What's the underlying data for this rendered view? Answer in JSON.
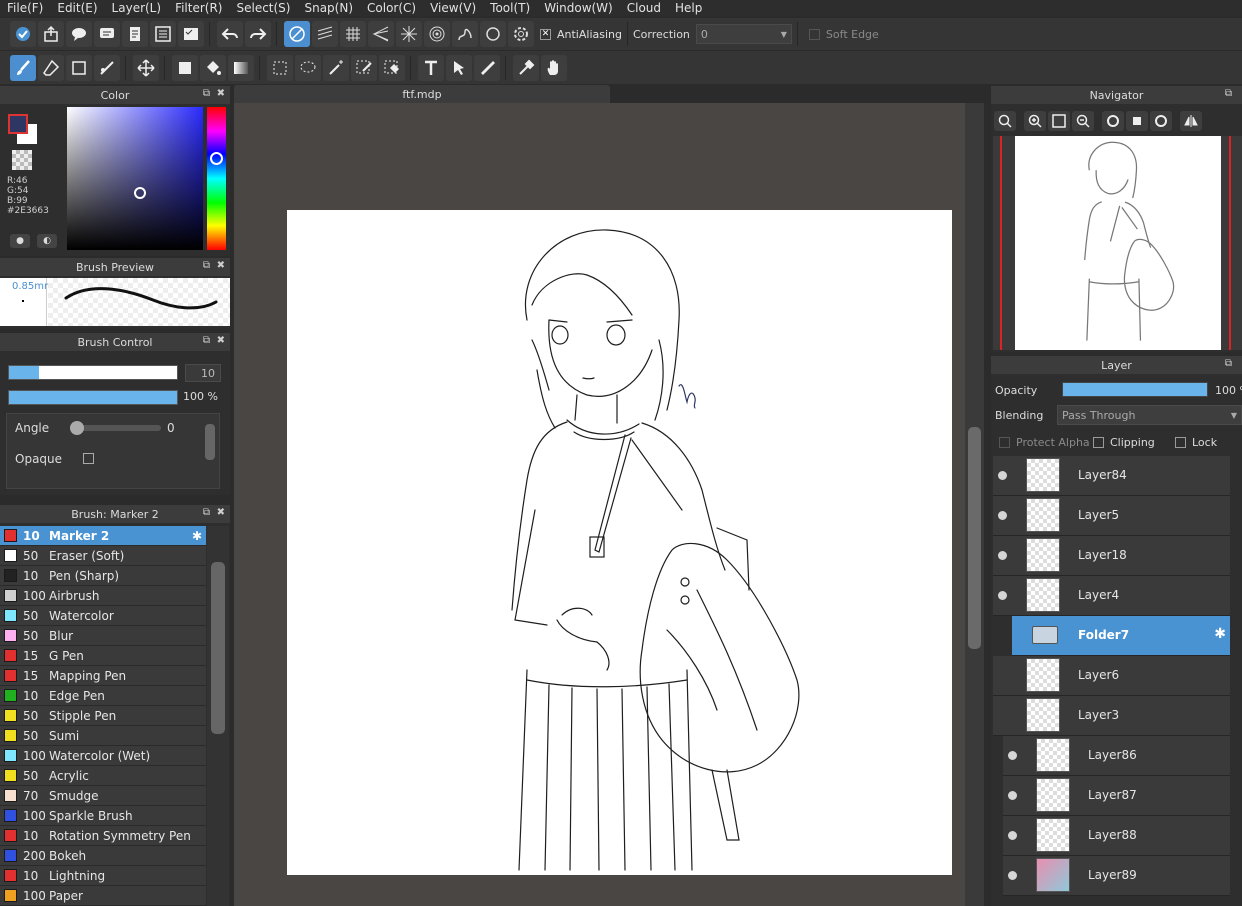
{
  "menu": [
    "File(F)",
    "Edit(E)",
    "Layer(L)",
    "Filter(R)",
    "Select(S)",
    "Snap(N)",
    "Color(C)",
    "View(V)",
    "Tool(T)",
    "Window(W)",
    "Cloud",
    "Help"
  ],
  "toolbar": {
    "antialiasing_label": "AntiAliasing",
    "correction_label": "Correction",
    "correction_value": "0",
    "soft_edge_label": "Soft Edge"
  },
  "color_panel": {
    "title": "Color",
    "r": "R:46",
    "g": "G:54",
    "b": "B:99",
    "hex": "#2E3663"
  },
  "brush_preview": {
    "title": "Brush Preview",
    "size": "0.85mm"
  },
  "brush_control": {
    "title": "Brush Control",
    "size_value": "10",
    "opacity_value": "100 %",
    "opacity_level": 1.0,
    "size_level": 0.18,
    "angle_label": "Angle",
    "angle_value": "0",
    "opaque_label": "Opaque"
  },
  "brush_list": {
    "title": "Brush: Marker 2",
    "items": [
      {
        "size": "10",
        "name": "Marker 2",
        "color": "#e03030",
        "selected": true
      },
      {
        "size": "50",
        "name": "Eraser (Soft)",
        "color": "#ffffff"
      },
      {
        "size": "10",
        "name": "Pen (Sharp)",
        "color": "#222222"
      },
      {
        "size": "100",
        "name": "Airbrush",
        "color": "#d0d0d0"
      },
      {
        "size": "50",
        "name": "Watercolor",
        "color": "#7fe6ff"
      },
      {
        "size": "50",
        "name": "Blur",
        "color": "#ffb0f0"
      },
      {
        "size": "15",
        "name": "G Pen",
        "color": "#e03030"
      },
      {
        "size": "15",
        "name": "Mapping Pen",
        "color": "#e03030"
      },
      {
        "size": "10",
        "name": "Edge Pen",
        "color": "#20b020"
      },
      {
        "size": "50",
        "name": "Stipple Pen",
        "color": "#f0e020"
      },
      {
        "size": "50",
        "name": "Sumi",
        "color": "#f0e020"
      },
      {
        "size": "100",
        "name": "Watercolor (Wet)",
        "color": "#7fe6ff"
      },
      {
        "size": "50",
        "name": "Acrylic",
        "color": "#f0e020"
      },
      {
        "size": "70",
        "name": "Smudge",
        "color": "#f8e0d0"
      },
      {
        "size": "100",
        "name": "Sparkle Brush",
        "color": "#3050e0"
      },
      {
        "size": "10",
        "name": "Rotation Symmetry Pen",
        "color": "#e03030"
      },
      {
        "size": "200",
        "name": "Bokeh",
        "color": "#3050e0"
      },
      {
        "size": "10",
        "name": "Lightning",
        "color": "#e03030"
      },
      {
        "size": "100",
        "name": "Paper",
        "color": "#f0a020"
      }
    ]
  },
  "document": {
    "tab": "ftf.mdp"
  },
  "navigator": {
    "title": "Navigator"
  },
  "layer_panel": {
    "title": "Layer",
    "opacity_label": "Opacity",
    "opacity_value": "100 %",
    "blending_label": "Blending",
    "blending_value": "Pass Through",
    "protect_alpha": "Protect Alpha",
    "clipping": "Clipping",
    "lock": "Lock",
    "layers": [
      {
        "name": "Layer84",
        "visible": true,
        "indent": 0
      },
      {
        "name": "Layer5",
        "visible": true,
        "indent": 0
      },
      {
        "name": "Layer18",
        "visible": true,
        "indent": 0
      },
      {
        "name": "Layer4",
        "visible": true,
        "indent": 0
      },
      {
        "name": "Folder7",
        "visible": false,
        "indent": 0,
        "folder": true,
        "selected": true
      },
      {
        "name": "Layer6",
        "visible": false,
        "indent": 0
      },
      {
        "name": "Layer3",
        "visible": false,
        "indent": 0
      },
      {
        "name": "Layer86",
        "visible": true,
        "indent": 1
      },
      {
        "name": "Layer87",
        "visible": true,
        "indent": 1
      },
      {
        "name": "Layer88",
        "visible": true,
        "indent": 1
      },
      {
        "name": "Layer89",
        "visible": true,
        "indent": 1
      }
    ]
  },
  "colors": {
    "accent": "#4a93d2",
    "panel": "#2e2e2e",
    "canvas_bg": "#4a4644"
  }
}
